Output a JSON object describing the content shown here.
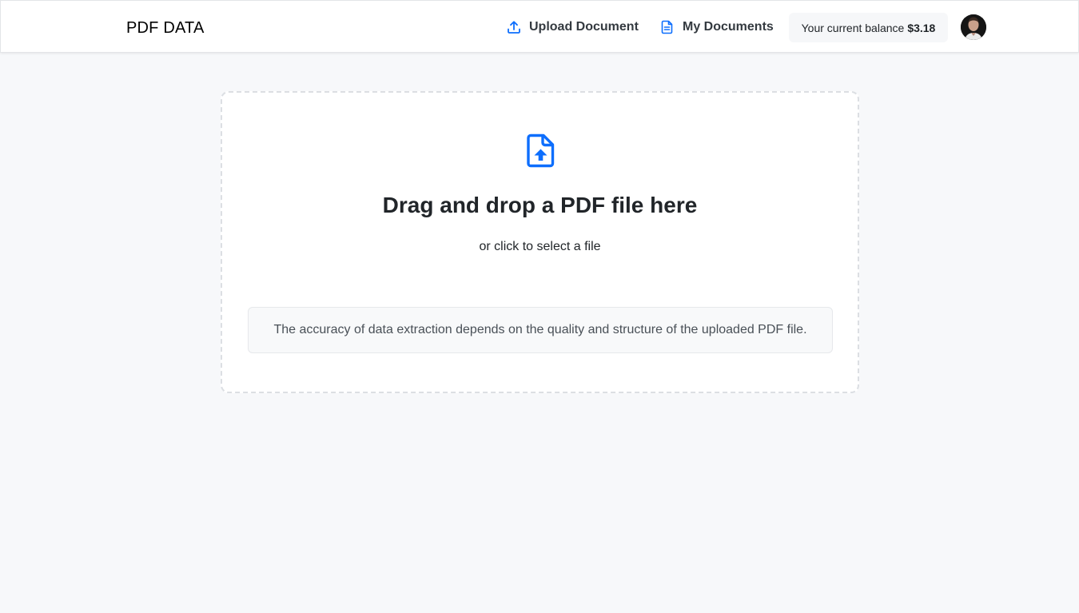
{
  "header": {
    "brand": "PDF DATA",
    "nav": {
      "upload_label": "Upload Document",
      "upload_icon": "upload-icon",
      "documents_label": "My Documents",
      "documents_icon": "document-icon"
    },
    "balance": {
      "label": "Your current balance",
      "amount": "$3.18"
    },
    "avatar_icon": "user-avatar"
  },
  "upload": {
    "icon": "file-upload-icon",
    "title": "Drag and drop a PDF file here",
    "subtitle": "or click to select a file",
    "notice": "The accuracy of data extraction depends on the quality and structure of the uploaded PDF file."
  },
  "colors": {
    "accent": "#0d6efd",
    "background": "#f7f8fa",
    "header_bg": "#ffffff"
  }
}
